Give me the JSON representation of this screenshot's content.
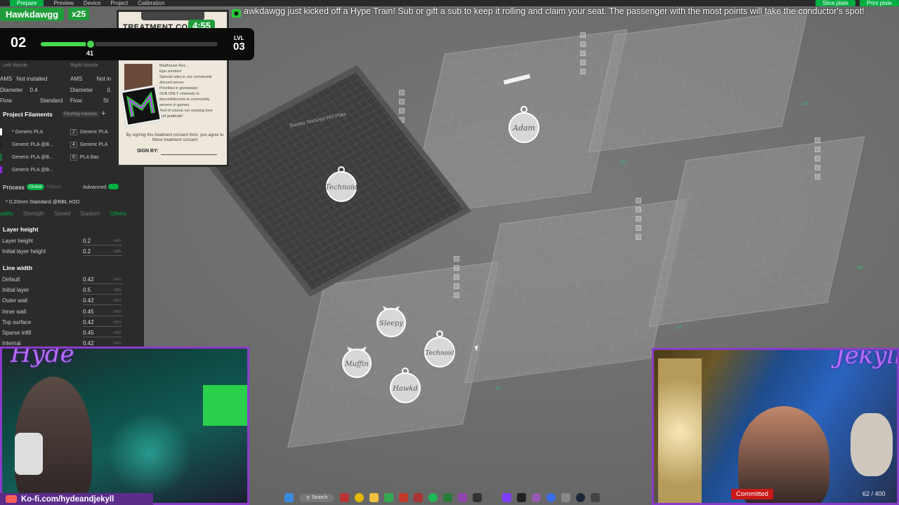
{
  "topbar": {
    "tabs": [
      {
        "label": "Prepare",
        "active": true
      },
      {
        "label": "Preview",
        "active": false
      },
      {
        "label": "Device",
        "active": false
      },
      {
        "label": "Project",
        "active": false
      },
      {
        "label": "Calibration",
        "active": false
      }
    ],
    "slice_button": "Slice plate",
    "print_button": "Print plate"
  },
  "ticker": {
    "text": "awkdawgg just kicked off a Hype Train! Sub or gift a sub to keep it rolling and claim your seat. The passenger with the most points will take the conductor's spot!",
    "behind_text": "ng"
  },
  "hype_train": {
    "conductor": "Hawkdawgg",
    "multiplier": "x25",
    "timer": "4:55",
    "level_current": "02",
    "level_next": "03",
    "level_label": "LVL",
    "progress_count": "41",
    "progress_fraction": 0.28,
    "accent": "#46d84c"
  },
  "card": {
    "title": "TREATMENT CO",
    "perks": [
      "Madhouse Res...",
      "Epic emotes!",
      "Special roles in our community",
      "discord server",
      "Priorities in giveaways",
      "SUB ONLY channels in",
      "discord/Access to community",
      "servers in games.",
      "And of course our undying love",
      "and gratitude!"
    ],
    "consent": "By signing this treatment consent form, you agree to these treatment consent",
    "sign_label": "SIGN BY:"
  },
  "left_panel": {
    "left_nozzle": "Left Nozzle",
    "right_nozzle": "Right Nozzle",
    "ams_label": "AMS",
    "ams_value": "Not installed",
    "ams_value_right": "Not in",
    "diameter_label": "Diameter",
    "diameter_value": "0.4",
    "diameter_value_right": "0.",
    "flow_label": "Flow",
    "flow_value": "Standard",
    "flow_value_right": "St",
    "filaments_title": "Project Filaments",
    "flushing_btn": "Flushing volumes",
    "filaments": [
      {
        "num": "1",
        "name": "* Generic PLA",
        "color": "#ffffff"
      },
      {
        "num": "3",
        "name": "Generic PLA @B...",
        "color": "#222222"
      },
      {
        "num": "5",
        "name": "Generic PLA @B...",
        "color": "#1a6b3a"
      },
      {
        "num": "7",
        "name": "Generic PLA @B...",
        "color": "#8a2be2"
      }
    ],
    "filaments_right": [
      {
        "num": "2",
        "name": "Generic PLA"
      },
      {
        "num": "4",
        "name": "Generic PLA"
      },
      {
        "num": "6",
        "name": "PLA Bas"
      }
    ],
    "process_title": "Process",
    "global_tag": "Global",
    "objects_tag": "Objects",
    "advanced_label": "Advanced",
    "profile": "* 0.20mm Standard @BBL H2D",
    "tabs": [
      "uality",
      "Strength",
      "Speed",
      "Support",
      "Others"
    ],
    "layer_height_section": "Layer height",
    "line_width_section": "Line width",
    "params": [
      {
        "label": "Layer height",
        "value": "0.2",
        "unit": "mm"
      },
      {
        "label": "Initial layer height",
        "value": "0.2",
        "unit": "mm"
      },
      {
        "label": "Default",
        "value": "0.42",
        "unit": "mm"
      },
      {
        "label": "Initial layer",
        "value": "0.5",
        "unit": "mm"
      },
      {
        "label": "Outer wall",
        "value": "0.42",
        "unit": "mm"
      },
      {
        "label": "Inner wall",
        "value": "0.45",
        "unit": "mm"
      },
      {
        "label": "Top surface",
        "value": "0.42",
        "unit": "mm"
      },
      {
        "label": "Sparse infill",
        "value": "0.45",
        "unit": "mm"
      },
      {
        "label": "Internal",
        "value": "0.42",
        "unit": "mm"
      }
    ]
  },
  "plates": {
    "active_label": "Bambu Textured PEI Plate",
    "nums": [
      "01",
      "02",
      "03",
      "04",
      "05",
      "06"
    ],
    "ornaments": [
      "Technoid",
      "Adam",
      "Sleepy",
      "Muffin",
      "Technoid",
      "Hawkd"
    ]
  },
  "streamers": {
    "left": "Hyde",
    "right": "Jekyll",
    "frame_color": "#8b3bc9"
  },
  "kofi": {
    "text": "Ko-fi.com/hydeandjekyll"
  },
  "taskbar": {
    "search": "Search"
  },
  "overlay": {
    "committed": "Committed",
    "counter": "62 / 400"
  }
}
